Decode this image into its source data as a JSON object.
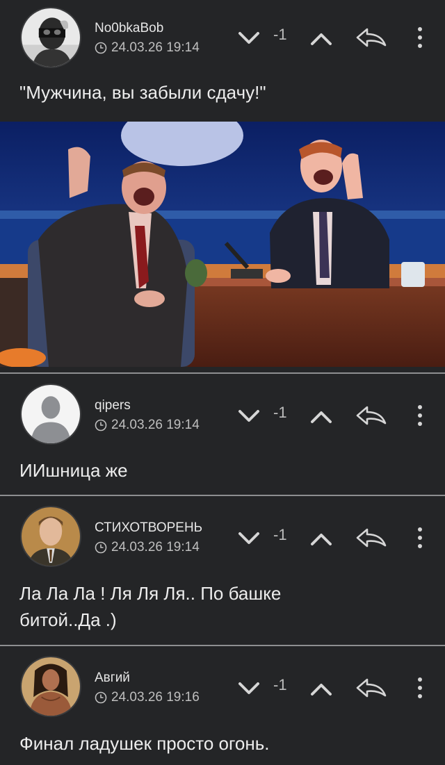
{
  "comments": [
    {
      "username": "No0bkaBob",
      "time": "24.03.26 19:14",
      "rating": "-1",
      "text": "\"Мужчина, вы забыли сдачу!\"",
      "avatar_icon": "masked-man-avatar",
      "has_image": true
    },
    {
      "username": "qipers",
      "time": "24.03.26 19:14",
      "rating": "-1",
      "text": "ИИшница же",
      "avatar_icon": "default-user-avatar"
    },
    {
      "username": "СТИХОТВОРЕНЬ",
      "time": "24.03.26 19:14",
      "rating": "-1",
      "text": "Ла Ла Ла ! Ля Ля Ля.. По башке битой..Да .)",
      "avatar_icon": "man-portrait-avatar"
    },
    {
      "username": "Авгий",
      "time": "24.03.26 19:16",
      "rating": "-1",
      "text": "Финал ладушек просто огонь.",
      "avatar_icon": "warrior-avatar"
    }
  ],
  "colors": {
    "background": "#242527",
    "divider": "#8e8f91",
    "icon": "#d6d6d6"
  },
  "icons": [
    "chevron-down-icon",
    "chevron-up-icon",
    "reply-arrow-icon",
    "more-vertical-icon",
    "clock-icon"
  ]
}
